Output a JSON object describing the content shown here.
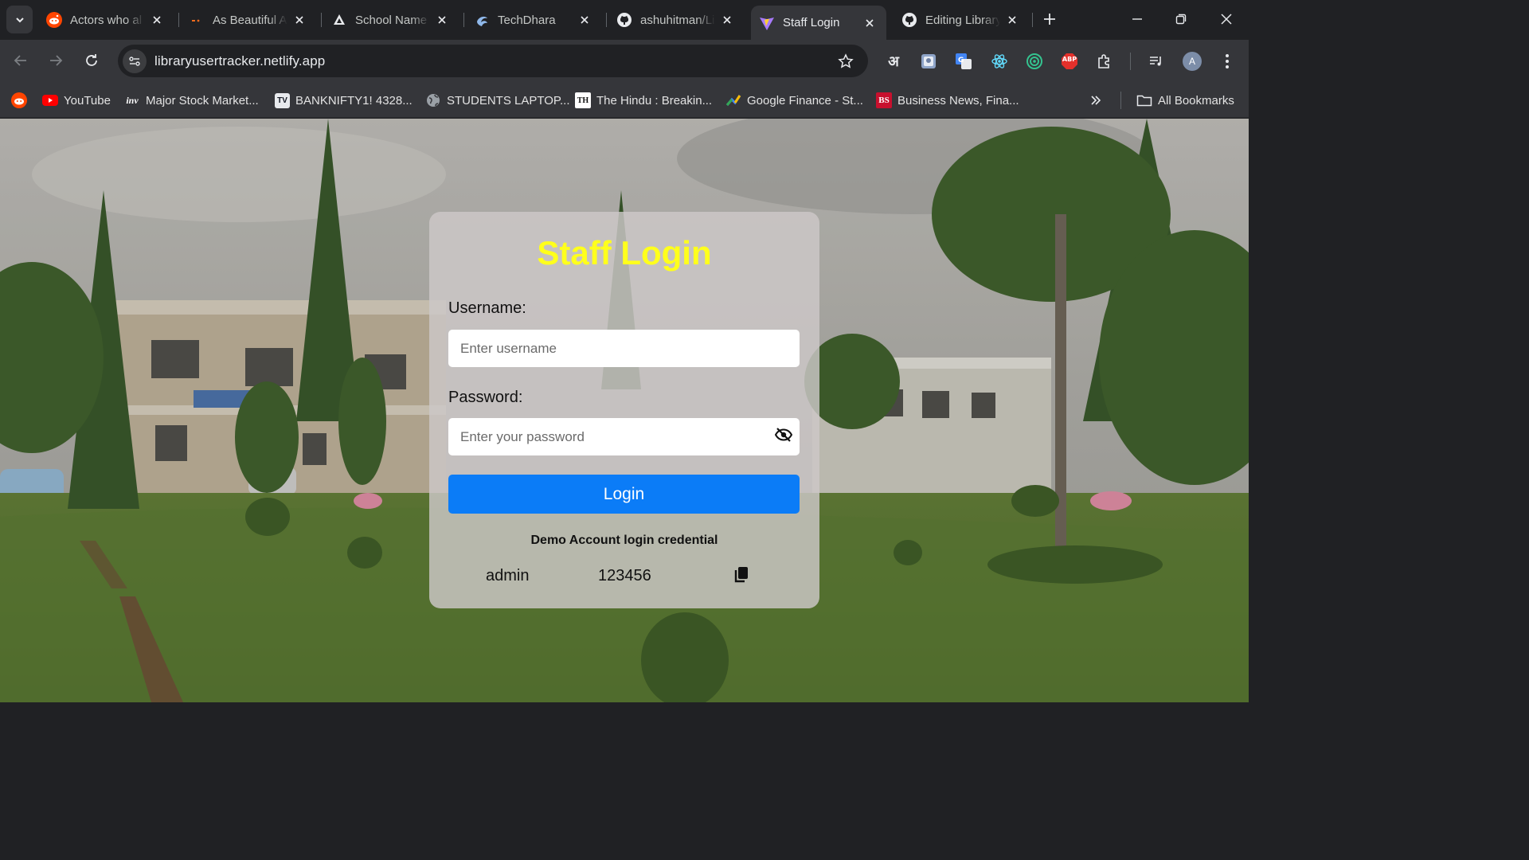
{
  "browser": {
    "tabs": [
      {
        "title": "Actors who al",
        "favicon": "reddit-icon",
        "active": false
      },
      {
        "title": "As Beautiful A",
        "favicon": "site-icon",
        "active": false
      },
      {
        "title": "School Name",
        "favicon": "vercel-icon",
        "active": false
      },
      {
        "title": "TechDhara",
        "favicon": "techdhara-icon",
        "active": false
      },
      {
        "title": "ashuhitman/Li",
        "favicon": "github-icon",
        "active": false
      },
      {
        "title": "Staff Login",
        "favicon": "vite-icon",
        "active": true
      },
      {
        "title": "Editing Library",
        "favicon": "github-icon",
        "active": false
      }
    ],
    "url": "libraryusertracker.netlify.app",
    "profile_initial": "A",
    "hindi_glyph": "अ",
    "abp_label": "ABP",
    "bookmarks": [
      {
        "label": "",
        "icon": "reddit-icon"
      },
      {
        "label": "YouTube",
        "icon": "youtube-icon"
      },
      {
        "label": "Major Stock Market...",
        "icon": "inv-icon",
        "icon_text": "inv"
      },
      {
        "label": "BANKNIFTY1! 4328...",
        "icon": "tradingview-icon",
        "icon_text": "TV"
      },
      {
        "label": "STUDENTS LAPTOP...",
        "icon": "globe-icon"
      },
      {
        "label": "The Hindu : Breakin...",
        "icon": "thehindu-icon",
        "icon_text": "TH"
      },
      {
        "label": "Google Finance - St...",
        "icon": "google-finance-icon"
      },
      {
        "label": "Business News, Fina...",
        "icon": "business-standard-icon",
        "icon_text": "BS"
      }
    ],
    "all_bookmarks_label": "All Bookmarks"
  },
  "login": {
    "title": "Staff Login",
    "username_label": "Username:",
    "username_placeholder": "Enter username",
    "password_label": "Password:",
    "password_placeholder": "Enter your password",
    "button_label": "Login",
    "demo_title": "Demo Account login credential",
    "demo_username": "admin",
    "demo_password": "123456"
  },
  "colors": {
    "title_yellow": "#ffff1c",
    "button_blue": "#0b7cf7",
    "chrome_dark": "#202124",
    "chrome_toolbar": "#35363a"
  }
}
